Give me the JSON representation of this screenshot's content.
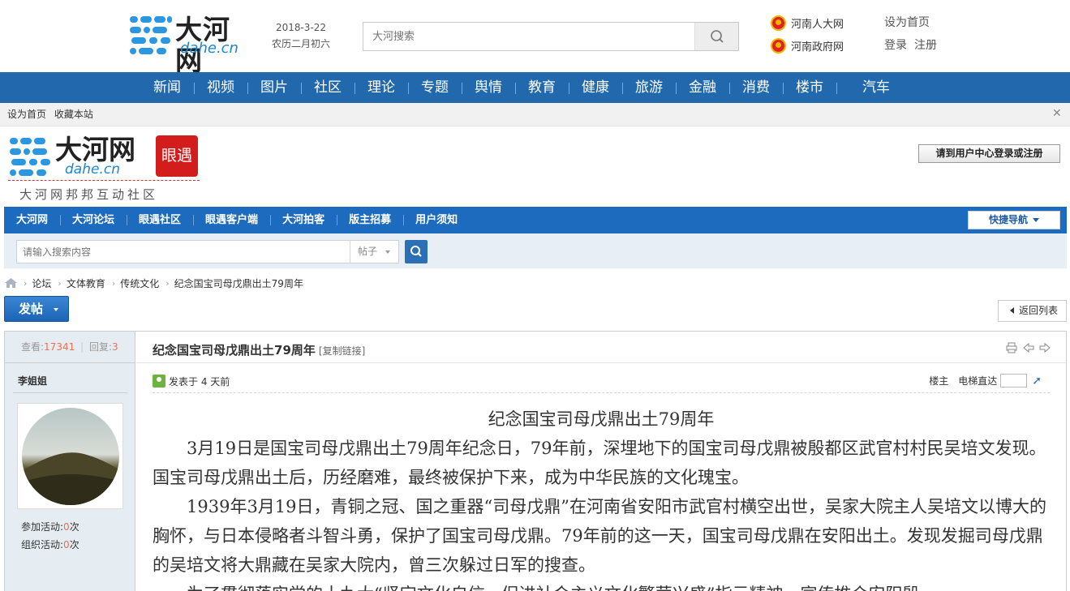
{
  "top": {
    "logo_cn": "大河网",
    "logo_en": "dahe.cn",
    "date": "2018-3-22",
    "lunar": "农历二月初六",
    "search_placeholder": "大河搜索",
    "links": [
      "河南人大网",
      "河南政府网"
    ],
    "set_home": "设为首页",
    "login": "登录",
    "register": "注册"
  },
  "main_nav": [
    "新闻",
    "视频",
    "图片",
    "社区",
    "理论",
    "专题",
    "舆情",
    "教育",
    "健康",
    "旅游",
    "金融",
    "消费",
    "楼市",
    "汽车"
  ],
  "toolbar": {
    "set_home": "设为首页",
    "bookmark": "收藏本站"
  },
  "forum": {
    "logo_cn": "大河网",
    "logo_en": "dahe.cn",
    "eye_badge": "眼遇",
    "slogan": "大河网邦邦互动社区",
    "login_button": "请到用户中心登录或注册",
    "nav": [
      "大河网",
      "大河论坛",
      "眼遇社区",
      "眼遇客户端",
      "大河拍客",
      "版主招募",
      "用户须知"
    ],
    "quick_nav": "快捷导航",
    "search_placeholder": "请输入搜索内容",
    "search_type": "帖子"
  },
  "breadcrumb": [
    "论坛",
    "文体教育",
    "传统文化",
    "纪念国宝司母戊鼎出土79周年"
  ],
  "post_button": "发帖",
  "back_button": "返回列表",
  "post": {
    "views_label": "查看:",
    "views": "17341",
    "replies_label": "回复:",
    "replies": "3",
    "author": "李姐姐",
    "activity_join_label": "参加活动:",
    "activity_join": "0",
    "activity_org_label": "组织活动:",
    "activity_org": "0",
    "unit": "次",
    "title": "纪念国宝司母戊鼎出土79周年",
    "copy_link": "[复制链接]",
    "posted": "发表于 4 天前",
    "floor_owner": "楼主",
    "elevator": "电梯直达",
    "content_title": "纪念国宝司母戊鼎出土79周年",
    "paragraphs": [
      "3月19日是国宝司母戊鼎出土79周年纪念日，79年前，深埋地下的国宝司母戊鼎被殷都区武官村村民吴培文发现。国宝司母戊鼎出土后，历经磨难，最终被保护下来，成为中华民族的文化瑰宝。",
      "1939年3月19日，青铜之冠、国之重器“司母戊鼎”在河南省安阳市武官村横空出世，吴家大院主人吴培文以博大的胸怀，与日本侵略者斗智斗勇，保护了国宝司母戊鼎。79年前的这一天，国宝司母戊鼎在安阳出土。发现发掘司母戊鼎的吴培文将大鼎藏在吴家大院内，曾三次躲过日军的搜查。",
      "为了贯彻落实党的十九大“坚定文化自信，促进社会主义文化繁荣兴盛”指示精神，宣传推介安阳殷"
    ]
  },
  "colors": {
    "nav_blue": "#2168ad",
    "forum_blue": "#1d6bbf",
    "accent_red": "#f26c4f"
  }
}
